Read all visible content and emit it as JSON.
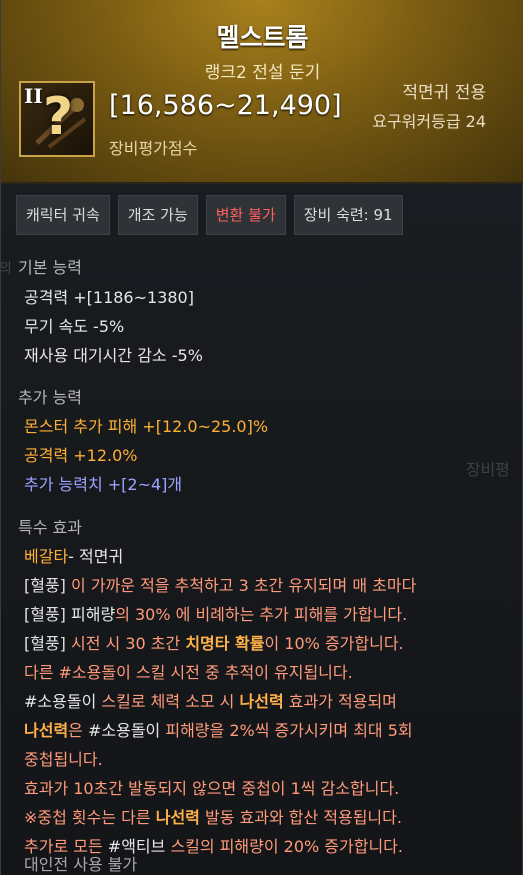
{
  "item": {
    "name": "멜스트롬",
    "rank_label": "랭크2 전설 둔기",
    "icon_roman": "II",
    "icon_symbol": "question-mark",
    "score_value": "[16,586~21,490]",
    "score_label": "장비평가점수",
    "class_restriction": "적면귀 전용",
    "level_requirement": "요구워커등급 24"
  },
  "tags": [
    {
      "label": "캐릭터 귀속",
      "color": "#dcdcdc"
    },
    {
      "label": "개조 가능",
      "color": "#dcdcdc"
    },
    {
      "label": "변환 불가",
      "color": "#ff5f5f"
    },
    {
      "label": "장비 숙련: 91",
      "color": "#dcdcdc"
    }
  ],
  "basic": {
    "heading": "기본 능력",
    "lines": [
      "공격력  +[1186~1380]",
      "무기 속도 -5%",
      "재사용 대기시간 감소 -5%"
    ]
  },
  "extra": {
    "heading": "추가 능력",
    "lines": [
      {
        "text": "몬스터 추가 피해  +[12.0~25.0]%",
        "color": "#ffb033"
      },
      {
        "text": "공격력  +12.0%",
        "color": "#ffb033"
      },
      {
        "text": "추가 능력치 +[2~4]개",
        "color": "#9ea3ff"
      }
    ]
  },
  "special": {
    "heading": "특수 효과",
    "set_name": "베갈타",
    "set_suffix": "- 적면귀",
    "line1": {
      "tag": "[혈풍]",
      "text": " 이 가까운 적을 추척하고 3 초간 유지되며 매 초마다"
    },
    "line2": {
      "tag": "[혈풍]",
      "pre": " 피해량",
      "text": "의 30% 에 비례하는 추가 피해를 가합니다."
    },
    "line3": {
      "tag": "[혈풍]",
      "pre": " 시전 시 30 초간 ",
      "hl": "치명타 확률",
      "post": "이 10% 증가합니다."
    },
    "line4": "다른 #소용돌이 스킬 시전 중 추적이 유지됩니다.",
    "line5": {
      "a": "#소용돌이",
      "b": " 스킬로 체력 소모 시 ",
      "c": "나선력",
      "d": " 효과가 적용되며"
    },
    "line6": {
      "a": "나선력",
      "b": "은 ",
      "c": "#소용돌이",
      "d": " 피해량을 2%씩 증가시키며 최대 5회"
    },
    "line7": "중첩됩니다.",
    "line8": "효과가 10초간 발동되지 않으면 중첩이 1씩 감소합니다.",
    "line9": {
      "a": "※중첩 횟수는 다른 ",
      "b": "나선력",
      "c": " 발동 효과와 합산 적용됩니다."
    },
    "line10": {
      "a": "추가로 모든 ",
      "b": "#액티브",
      "c": " 스킬의 피해량이 20% 증가합니다."
    },
    "line11": "대인전 사용 불가"
  },
  "background_text": {
    "left_fragment": "의",
    "right_fragment": "장비평"
  },
  "colors": {
    "header_gold": "#a9811d",
    "highlight_orange": "#ffb033",
    "blue_stat": "#9ea3ff",
    "red_tag": "#ff5f5f"
  }
}
